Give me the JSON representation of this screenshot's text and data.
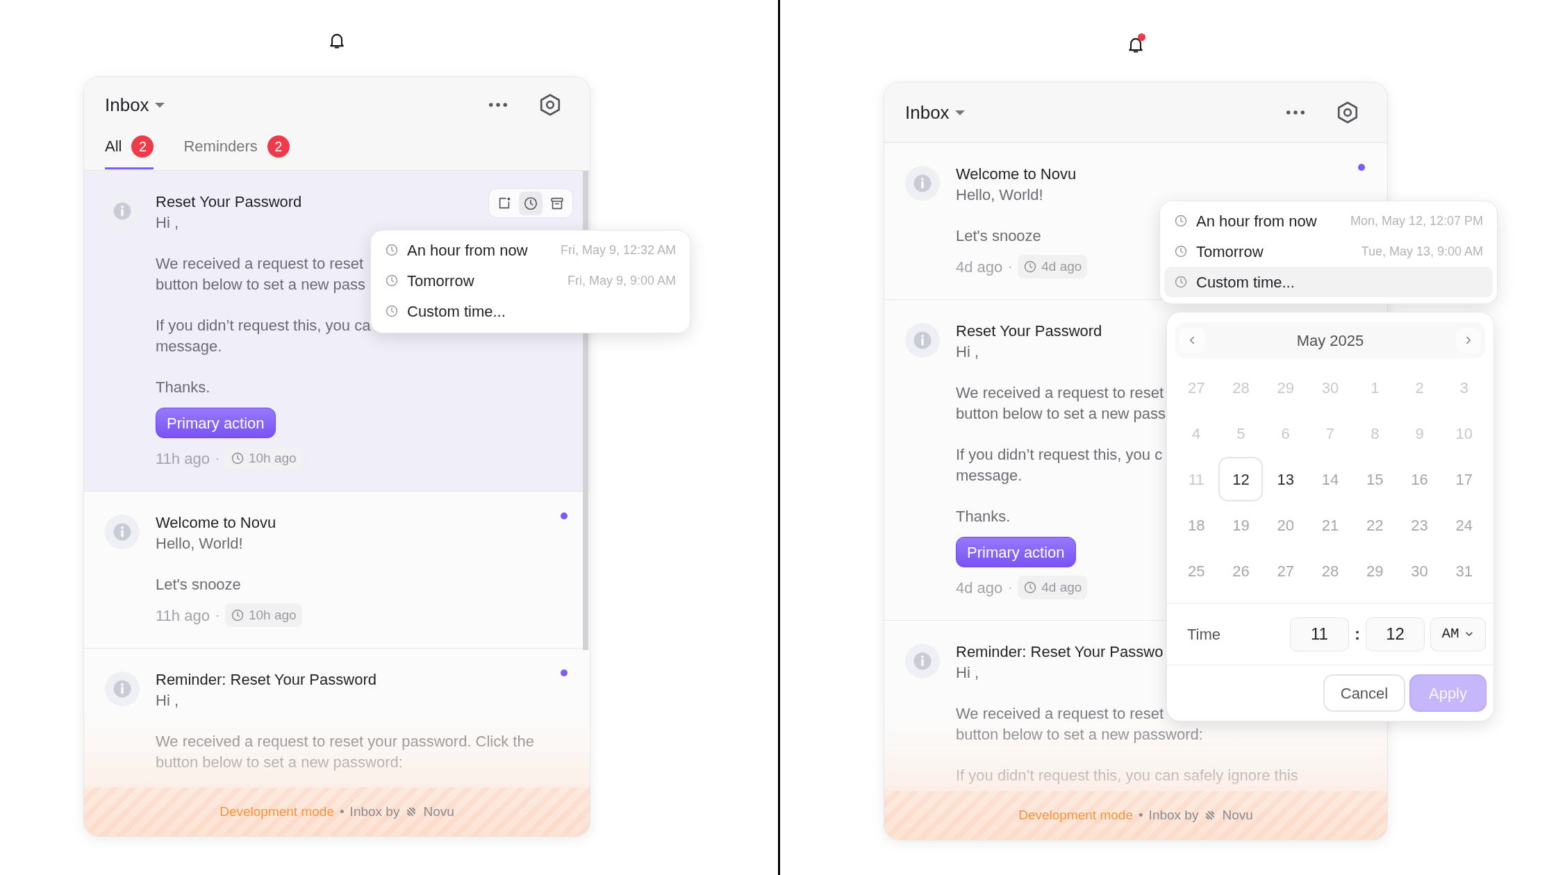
{
  "panels": [
    {
      "bell": {
        "unread": false
      },
      "header": {
        "title": "Inbox"
      },
      "tabs": [
        {
          "label": "All",
          "count": "2",
          "selected": true
        },
        {
          "label": "Reminders",
          "count": "2",
          "selected": false
        }
      ],
      "notifications": [
        {
          "title": "Reset Your Password",
          "preview": "Hi ,",
          "paragraphs": [
            "We received a request to reset\nbutton below to set a new pass",
            "If you didn’t request this, you ca\nmessage.",
            "Thanks."
          ],
          "action": "Primary action",
          "time": "11h ago",
          "separator": "·",
          "snoozed_until": "10h ago",
          "hovered": true,
          "unread": false,
          "actions": [
            {
              "kind": "read",
              "active": false
            },
            {
              "kind": "snooze",
              "active": true
            },
            {
              "kind": "archive",
              "active": false
            }
          ]
        },
        {
          "title": "Welcome to Novu",
          "preview": "Hello, World!",
          "paragraphs": [
            "Let's snooze"
          ],
          "time": "11h ago",
          "separator": "·",
          "snoozed_until": "10h ago",
          "hovered": false,
          "unread": true
        },
        {
          "title": "Reminder: Reset Your Password",
          "preview": "Hi ,",
          "paragraphs": [
            "We received a request to reset your password. Click the\nbutton below to set a new password:"
          ],
          "hovered": false,
          "unread": true
        }
      ],
      "snooze_menu": {
        "options": [
          {
            "label": "An hour from now",
            "time": "Fri, May 9, 12:32 AM",
            "selected": false
          },
          {
            "label": "Tomorrow",
            "time": "Fri, May 9, 9:00 AM",
            "selected": false
          },
          {
            "label": "Custom time...",
            "selected": false
          }
        ]
      },
      "footer": {
        "mode": "Development mode",
        "separator": "•",
        "by": "Inbox by",
        "brand": "Novu"
      }
    },
    {
      "bell": {
        "unread": true
      },
      "header": {
        "title": "Inbox"
      },
      "notifications": [
        {
          "title": "Welcome to Novu",
          "preview": "Hello, World!",
          "paragraphs": [
            "Let's snooze"
          ],
          "time": "4d ago",
          "separator": "·",
          "snoozed_until": "4d ago",
          "hovered": false,
          "unread": true
        },
        {
          "title": "Reset Your Password",
          "preview": "Hi ,",
          "paragraphs": [
            "We received a request to reset\nbutton below to set a new pass",
            "If you didn’t request this, you c\nmessage.",
            "Thanks."
          ],
          "action": "Primary action",
          "time": "4d ago",
          "separator": "·",
          "snoozed_until": "4d ago",
          "hovered": false
        },
        {
          "title": "Reminder: Reset Your Passwo",
          "preview": "Hi ,",
          "paragraphs": [
            "We received a request to reset\nbutton below to set a new password:",
            "If you didn’t request this, you can safely ignore this"
          ],
          "hovered": false
        }
      ],
      "snooze_menu": {
        "options": [
          {
            "label": "An hour from now",
            "time": "Mon, May 12, 12:07 PM",
            "selected": false
          },
          {
            "label": "Tomorrow",
            "time": "Tue, May 13, 9:00 AM",
            "selected": false
          },
          {
            "label": "Custom time...",
            "selected": true
          }
        ]
      },
      "date_picker": {
        "month": "May 2025",
        "days": [
          {
            "label": "27",
            "selected": false,
            "disabled": true
          },
          {
            "label": "28",
            "selected": false,
            "disabled": true
          },
          {
            "label": "29",
            "selected": false,
            "disabled": true
          },
          {
            "label": "30",
            "selected": false,
            "disabled": true
          },
          {
            "label": "1",
            "selected": false,
            "disabled": true
          },
          {
            "label": "2",
            "selected": false,
            "disabled": true
          },
          {
            "label": "3",
            "selected": false,
            "disabled": true
          },
          {
            "label": "4",
            "selected": false,
            "disabled": true
          },
          {
            "label": "5",
            "selected": false,
            "disabled": true
          },
          {
            "label": "6",
            "selected": false,
            "disabled": true
          },
          {
            "label": "7",
            "selected": false,
            "disabled": true
          },
          {
            "label": "8",
            "selected": false,
            "disabled": true
          },
          {
            "label": "9",
            "selected": false,
            "disabled": true
          },
          {
            "label": "10",
            "selected": false,
            "disabled": true
          },
          {
            "label": "11",
            "selected": false,
            "disabled": true
          },
          {
            "label": "12",
            "selected": true,
            "disabled": false,
            "emphasized": true
          },
          {
            "label": "13",
            "selected": false,
            "disabled": false,
            "emphasized": true
          },
          {
            "label": "14",
            "selected": false,
            "disabled": false
          },
          {
            "label": "15",
            "selected": false,
            "disabled": false
          },
          {
            "label": "16",
            "selected": false,
            "disabled": false
          },
          {
            "label": "17",
            "selected": false,
            "disabled": false
          },
          {
            "label": "18",
            "selected": false,
            "disabled": false
          },
          {
            "label": "19",
            "selected": false,
            "disabled": false
          },
          {
            "label": "20",
            "selected": false,
            "disabled": false
          },
          {
            "label": "21",
            "selected": false,
            "disabled": false
          },
          {
            "label": "22",
            "selected": false,
            "disabled": false
          },
          {
            "label": "23",
            "selected": false,
            "disabled": false
          },
          {
            "label": "24",
            "selected": false,
            "disabled": false
          },
          {
            "label": "25",
            "selected": false,
            "disabled": false
          },
          {
            "label": "26",
            "selected": false,
            "disabled": false
          },
          {
            "label": "27",
            "selected": false,
            "disabled": false
          },
          {
            "label": "28",
            "selected": false,
            "disabled": false
          },
          {
            "label": "29",
            "selected": false,
            "disabled": false
          },
          {
            "label": "30",
            "selected": false,
            "disabled": false
          },
          {
            "label": "31",
            "selected": false,
            "disabled": false
          }
        ],
        "time_label": "Time",
        "hour": "11",
        "time_separator": ":",
        "minute": "12",
        "period": "AM",
        "buttons": [
          {
            "label": "Cancel",
            "kind": "secondary",
            "disabled": false
          },
          {
            "label": "Apply",
            "kind": "primary",
            "disabled": true
          }
        ]
      },
      "footer": {
        "mode": "Development mode",
        "separator": "•",
        "by": "Inbox by",
        "brand": "Novu"
      }
    }
  ]
}
